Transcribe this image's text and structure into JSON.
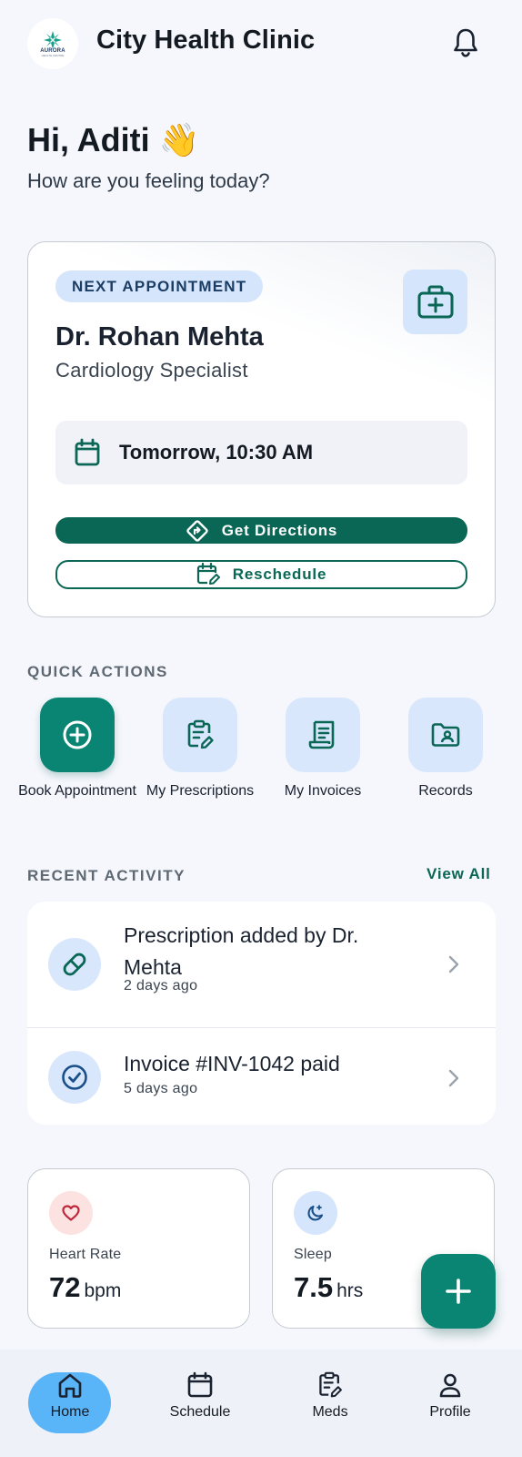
{
  "header": {
    "logo_text": "AURORA",
    "logo_sub": "HEALTH CENTRE",
    "title": "City Health Clinic",
    "notification_icon": "bell-icon"
  },
  "greeting": {
    "title": "Hi, Aditi 👋",
    "subtitle": "How are you feeling today?"
  },
  "appointment": {
    "badge": "NEXT APPOINTMENT",
    "doctor_name": "Dr. Rohan Mehta",
    "specialty": "Cardiology Specialist",
    "time": "Tomorrow, 10:30 AM",
    "directions_label": "Get Directions",
    "reschedule_label": "Reschedule"
  },
  "quick_actions": {
    "label": "QUICK ACTIONS",
    "items": [
      {
        "label": "Book Appointment",
        "icon": "plus-circle-icon"
      },
      {
        "label": "My Prescriptions",
        "icon": "prescription-icon"
      },
      {
        "label": "My Invoices",
        "icon": "receipt-icon"
      },
      {
        "label": "Records",
        "icon": "folder-user-icon"
      }
    ]
  },
  "recent_activity": {
    "label": "RECENT ACTIVITY",
    "view_all": "View All",
    "items": [
      {
        "title": "Prescription added by Dr. Mehta",
        "time": "2 days ago",
        "icon": "pill-icon"
      },
      {
        "title": "Invoice #INV-1042 paid",
        "time": "5 days ago",
        "icon": "check-circle-icon"
      }
    ]
  },
  "stats": {
    "heart_rate": {
      "label": "Heart Rate",
      "value": "72",
      "unit": "bpm",
      "icon": "heart-icon"
    },
    "sleep": {
      "label": "Sleep",
      "value": "7.5",
      "unit": "hrs",
      "icon": "moon-icon"
    }
  },
  "fab": {
    "icon": "plus-icon"
  },
  "bottom_nav": {
    "active": "Home",
    "items": [
      {
        "label": "Home",
        "icon": "home-icon"
      },
      {
        "label": "Schedule",
        "icon": "calendar-icon"
      },
      {
        "label": "Meds",
        "icon": "prescription-icon"
      },
      {
        "label": "Profile",
        "icon": "user-icon"
      }
    ]
  },
  "colors": {
    "primary": "#0a6755",
    "accent": "#0a8573",
    "tile_bg": "#d9e7fc",
    "nav_active": "#5ab4f8",
    "background": "#f5f7fc"
  }
}
